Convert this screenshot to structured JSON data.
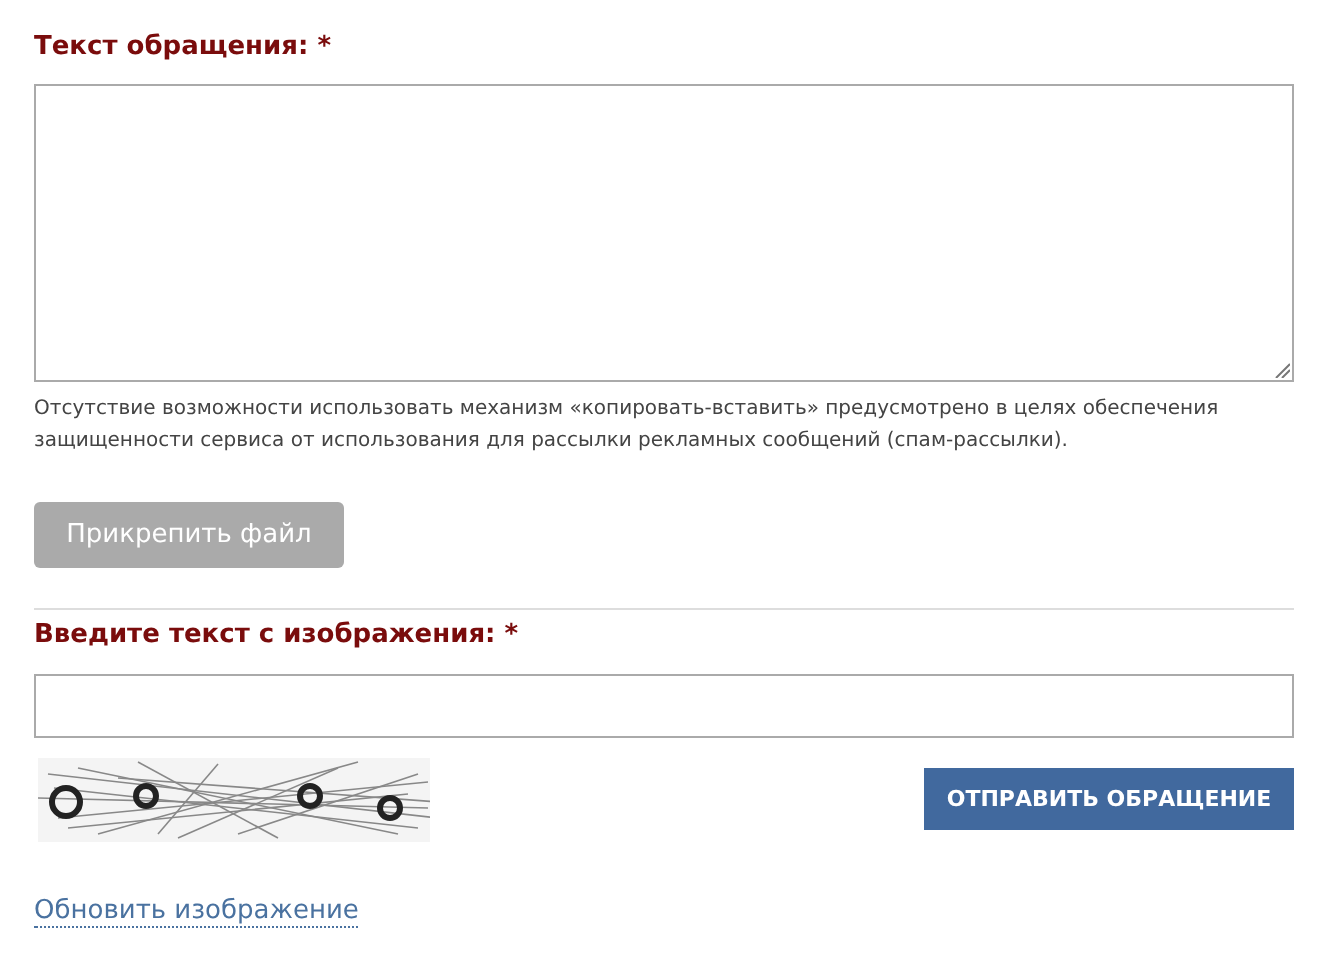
{
  "message": {
    "label": "Текст обращения:",
    "required_mark": "*",
    "note": "Отсутствие возможности использовать механизм «копировать-вставить» предусмотрено в целях обеспечения защищенности сервиса от использования для рассылки рекламных сообщений (спам-рассылки)."
  },
  "attach_button": "Прикрепить файл",
  "captcha": {
    "label": "Введите текст с изображения:",
    "required_mark": "*",
    "refresh_link": "Обновить изображение"
  },
  "submit_button": "ОТПРАВИТЬ ОБРАЩЕНИЕ"
}
